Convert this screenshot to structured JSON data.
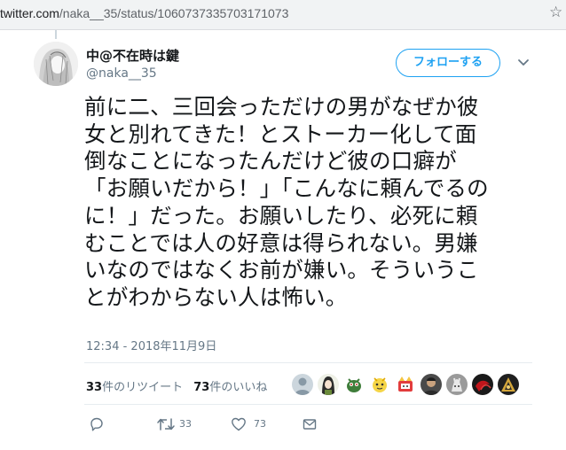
{
  "browser": {
    "url_domain": "twitter.com",
    "url_path": "/naka__35/status/1060737335703171073"
  },
  "tweet": {
    "display_name": "中@不在時は鍵",
    "username": "@naka__35",
    "follow_label": "フォローする",
    "text_lines": [
      "前に二、三回会っただけの男がなぜか彼",
      "女と別れてきた！とストーカー化して面",
      "倒なことになったんだけど彼の口癖が",
      "「お願いだから！」「こんなに頼んでるの",
      "に！」だった。お願いしたり、必死に頼",
      "むことでは人の好意は得られない。男嫌",
      "いなのではなくお前が嫌い。そういうこ",
      "とがわからない人は怖い。"
    ],
    "timestamp": "12:34 - 2018年11月9日"
  },
  "stats": {
    "retweet_count": "33",
    "retweet_label": "件のリツイート",
    "like_count": "73",
    "like_label": "件のいいね"
  },
  "actions": {
    "retweet_count": "33",
    "like_count": "73"
  },
  "colors": {
    "accent": "#1da1f2",
    "muted": "#657786",
    "text": "#14171a"
  },
  "icons": [
    "star-icon",
    "chevron-down-icon",
    "reply-icon",
    "retweet-icon",
    "like-icon",
    "message-icon"
  ]
}
